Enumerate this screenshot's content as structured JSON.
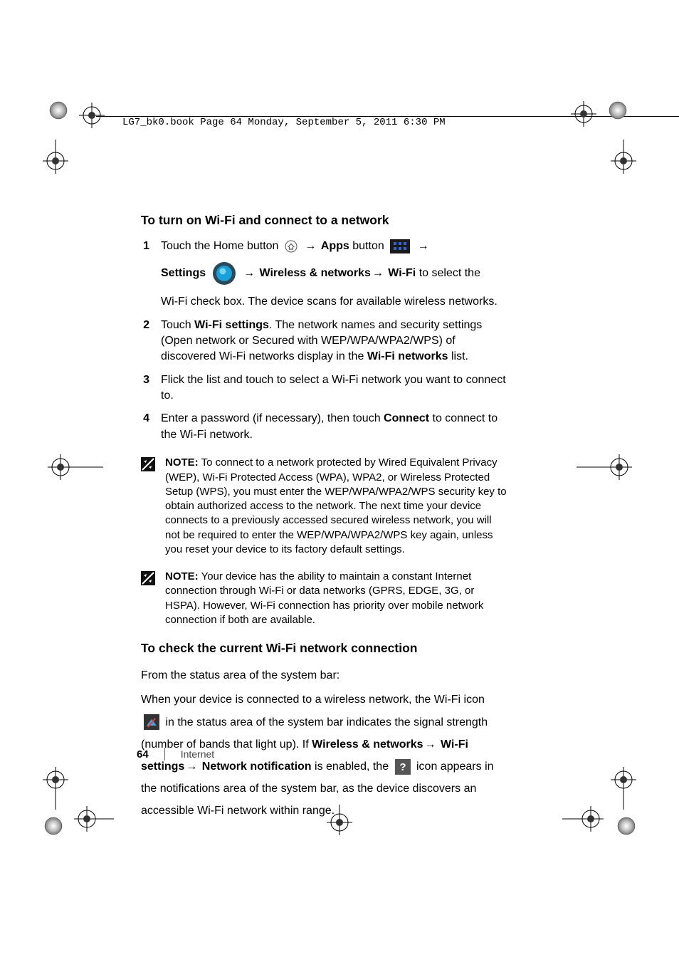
{
  "header": {
    "crop_text": "LG7_bk0.book  Page 64  Monday, September 5, 2011  6:30 PM"
  },
  "section1": {
    "heading": "To turn on Wi-Fi and connect to a network",
    "steps": {
      "s1": {
        "num": "1",
        "p1_a": "Touch the Home button ",
        "p1_b": " → ",
        "p1_apps": "Apps",
        "p1_c": " button ",
        "p1_d": " →",
        "p2_settings": "Settings",
        "p2_a": " → ",
        "p2_wn": "Wireless & networks",
        "p2_b": "→ ",
        "p2_wifi": "Wi-Fi",
        "p2_c": " to select the",
        "p3": "Wi-Fi check box. The device scans for available wireless networks."
      },
      "s2": {
        "num": "2",
        "a": "Touch ",
        "b": "Wi-Fi settings",
        "c": ". The network names and security settings (Open network or Secured with WEP/WPA/WPA2/WPS) of discovered Wi-Fi networks display in the ",
        "d": "Wi-Fi networks",
        "e": " list."
      },
      "s3": {
        "num": "3",
        "a": "Flick the list and touch to select a Wi-Fi network you want to connect to."
      },
      "s4": {
        "num": "4",
        "a": "Enter a password (if necessary), then touch ",
        "b": "Connect",
        "c": " to connect to the Wi-Fi network."
      }
    }
  },
  "note1": {
    "label": "NOTE:",
    "body": " To connect to a network protected by Wired Equivalent Privacy (WEP), Wi-Fi Protected Access (WPA), WPA2, or Wireless Protected Setup (WPS), you must enter the WEP/WPA/WPA2/WPS security key to obtain authorized access to the network. The next time your device connects to a previously accessed secured wireless network, you will not be required to enter the WEP/WPA/WPA2/WPS key again, unless you reset your device to its factory default settings."
  },
  "note2": {
    "label": "NOTE:",
    "body": " Your device has the ability to maintain a constant Internet connection through Wi-Fi or data networks (GPRS, EDGE, 3G, or HSPA). However, Wi-Fi connection has priority over mobile network connection if both are available."
  },
  "section2": {
    "heading": "To check the current Wi-Fi network connection",
    "p1": "From the status area of the system bar:",
    "p2a": "When your device is connected to a wireless network, the Wi-Fi icon ",
    "p2b": " in the status area of the system bar indicates the signal strength (number of bands that light up). If ",
    "p2c": "Wireless & networks",
    "p2d": "→ ",
    "p2e": "Wi-Fi settings",
    "p2f": "→ ",
    "p2g": "Network notification",
    "p2h": " is enabled, the ",
    "p2i": " icon appears in the notifications area of the system bar, as the device discovers an accessible Wi-Fi network within range."
  },
  "footer": {
    "page": "64",
    "section": "Internet"
  }
}
